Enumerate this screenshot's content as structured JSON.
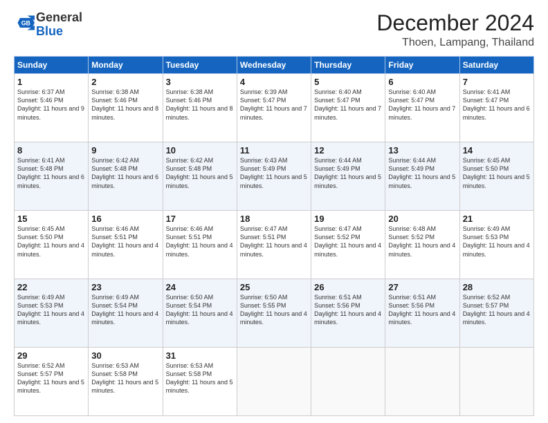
{
  "logo": {
    "general": "General",
    "blue": "Blue"
  },
  "header": {
    "month": "December 2024",
    "location": "Thoen, Lampang, Thailand"
  },
  "weekdays": [
    "Sunday",
    "Monday",
    "Tuesday",
    "Wednesday",
    "Thursday",
    "Friday",
    "Saturday"
  ],
  "weeks": [
    [
      {
        "day": "1",
        "sunrise": "6:37 AM",
        "sunset": "5:46 PM",
        "daylight": "11 hours and 9 minutes."
      },
      {
        "day": "2",
        "sunrise": "6:38 AM",
        "sunset": "5:46 PM",
        "daylight": "11 hours and 8 minutes."
      },
      {
        "day": "3",
        "sunrise": "6:38 AM",
        "sunset": "5:46 PM",
        "daylight": "11 hours and 8 minutes."
      },
      {
        "day": "4",
        "sunrise": "6:39 AM",
        "sunset": "5:47 PM",
        "daylight": "11 hours and 7 minutes."
      },
      {
        "day": "5",
        "sunrise": "6:40 AM",
        "sunset": "5:47 PM",
        "daylight": "11 hours and 7 minutes."
      },
      {
        "day": "6",
        "sunrise": "6:40 AM",
        "sunset": "5:47 PM",
        "daylight": "11 hours and 7 minutes."
      },
      {
        "day": "7",
        "sunrise": "6:41 AM",
        "sunset": "5:47 PM",
        "daylight": "11 hours and 6 minutes."
      }
    ],
    [
      {
        "day": "8",
        "sunrise": "6:41 AM",
        "sunset": "5:48 PM",
        "daylight": "11 hours and 6 minutes."
      },
      {
        "day": "9",
        "sunrise": "6:42 AM",
        "sunset": "5:48 PM",
        "daylight": "11 hours and 6 minutes."
      },
      {
        "day": "10",
        "sunrise": "6:42 AM",
        "sunset": "5:48 PM",
        "daylight": "11 hours and 5 minutes."
      },
      {
        "day": "11",
        "sunrise": "6:43 AM",
        "sunset": "5:49 PM",
        "daylight": "11 hours and 5 minutes."
      },
      {
        "day": "12",
        "sunrise": "6:44 AM",
        "sunset": "5:49 PM",
        "daylight": "11 hours and 5 minutes."
      },
      {
        "day": "13",
        "sunrise": "6:44 AM",
        "sunset": "5:49 PM",
        "daylight": "11 hours and 5 minutes."
      },
      {
        "day": "14",
        "sunrise": "6:45 AM",
        "sunset": "5:50 PM",
        "daylight": "11 hours and 5 minutes."
      }
    ],
    [
      {
        "day": "15",
        "sunrise": "6:45 AM",
        "sunset": "5:50 PM",
        "daylight": "11 hours and 4 minutes."
      },
      {
        "day": "16",
        "sunrise": "6:46 AM",
        "sunset": "5:51 PM",
        "daylight": "11 hours and 4 minutes."
      },
      {
        "day": "17",
        "sunrise": "6:46 AM",
        "sunset": "5:51 PM",
        "daylight": "11 hours and 4 minutes."
      },
      {
        "day": "18",
        "sunrise": "6:47 AM",
        "sunset": "5:51 PM",
        "daylight": "11 hours and 4 minutes."
      },
      {
        "day": "19",
        "sunrise": "6:47 AM",
        "sunset": "5:52 PM",
        "daylight": "11 hours and 4 minutes."
      },
      {
        "day": "20",
        "sunrise": "6:48 AM",
        "sunset": "5:52 PM",
        "daylight": "11 hours and 4 minutes."
      },
      {
        "day": "21",
        "sunrise": "6:49 AM",
        "sunset": "5:53 PM",
        "daylight": "11 hours and 4 minutes."
      }
    ],
    [
      {
        "day": "22",
        "sunrise": "6:49 AM",
        "sunset": "5:53 PM",
        "daylight": "11 hours and 4 minutes."
      },
      {
        "day": "23",
        "sunrise": "6:49 AM",
        "sunset": "5:54 PM",
        "daylight": "11 hours and 4 minutes."
      },
      {
        "day": "24",
        "sunrise": "6:50 AM",
        "sunset": "5:54 PM",
        "daylight": "11 hours and 4 minutes."
      },
      {
        "day": "25",
        "sunrise": "6:50 AM",
        "sunset": "5:55 PM",
        "daylight": "11 hours and 4 minutes."
      },
      {
        "day": "26",
        "sunrise": "6:51 AM",
        "sunset": "5:56 PM",
        "daylight": "11 hours and 4 minutes."
      },
      {
        "day": "27",
        "sunrise": "6:51 AM",
        "sunset": "5:56 PM",
        "daylight": "11 hours and 4 minutes."
      },
      {
        "day": "28",
        "sunrise": "6:52 AM",
        "sunset": "5:57 PM",
        "daylight": "11 hours and 4 minutes."
      }
    ],
    [
      {
        "day": "29",
        "sunrise": "6:52 AM",
        "sunset": "5:57 PM",
        "daylight": "11 hours and 5 minutes."
      },
      {
        "day": "30",
        "sunrise": "6:53 AM",
        "sunset": "5:58 PM",
        "daylight": "11 hours and 5 minutes."
      },
      {
        "day": "31",
        "sunrise": "6:53 AM",
        "sunset": "5:58 PM",
        "daylight": "11 hours and 5 minutes."
      },
      null,
      null,
      null,
      null
    ]
  ]
}
